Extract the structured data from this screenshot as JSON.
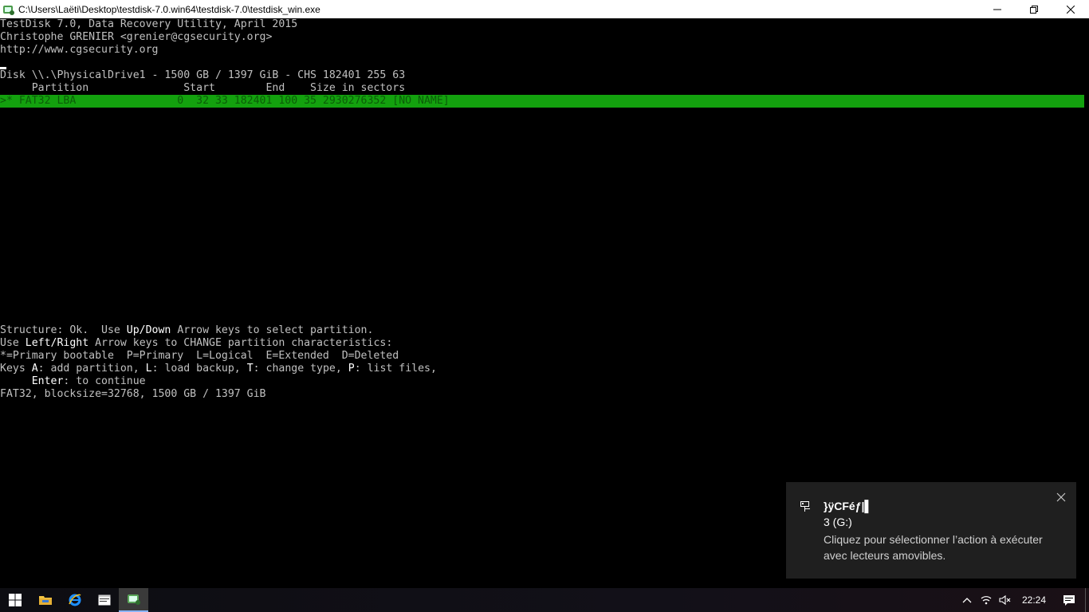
{
  "window": {
    "title": "C:\\Users\\Laëti\\Desktop\\testdisk-7.0.win64\\testdisk-7.0\\testdisk_win.exe"
  },
  "console": {
    "header": [
      "TestDisk 7.0, Data Recovery Utility, April 2015",
      "Christophe GRENIER <grenier@cgsecurity.org>",
      "http://www.cgsecurity.org"
    ],
    "disk_line": "Disk \\\\.\\PhysicalDrive1 - 1500 GB / 1397 GiB - CHS 182401 255 63",
    "columns_line": "     Partition               Start        End    Size in sectors",
    "partition_row": ">* FAT32 LBA                0  32 33 182401 100 35 2930276352 [NO NAME]",
    "help": {
      "l1_a": "Structure: Ok.  Use ",
      "l1_key": "Up/Down",
      "l1_b": " Arrow keys to select partition.",
      "l2_a": "Use ",
      "l2_key": "Left/Right",
      "l2_b": " Arrow keys to CHANGE partition characteristics:",
      "l3": "*=Primary bootable  P=Primary  L=Logical  E=Extended  D=Deleted",
      "l4_a": "Keys ",
      "l4_k1": "A",
      "l4_b": ": add partition, ",
      "l4_k2": "L",
      "l4_c": ": load backup, ",
      "l4_k3": "T",
      "l4_d": ": change type, ",
      "l4_k4": "P",
      "l4_e": ": list files,",
      "l5_a": "     ",
      "l5_key": "Enter",
      "l5_b": ": to continue",
      "l6": "FAT32, blocksize=32768, 1500 GB / 1397 GiB"
    }
  },
  "toast": {
    "title": "}ÿCFéƒ|▌",
    "subtitle": "3 (G:)",
    "body": "Cliquez pour sélectionner l’action à exécuter avec lecteurs amovibles.",
    "icon": "drive-icon"
  },
  "taskbar": {
    "clock": "22:24",
    "items": [
      "windows-start-icon",
      "file-explorer-icon",
      "internet-explorer-icon",
      "console-window-icon",
      "testdisk-icon"
    ]
  },
  "colors": {
    "selection": "#13a10e",
    "console_text": "#c0c0c0",
    "toast_bg": "#1f1f1f"
  }
}
